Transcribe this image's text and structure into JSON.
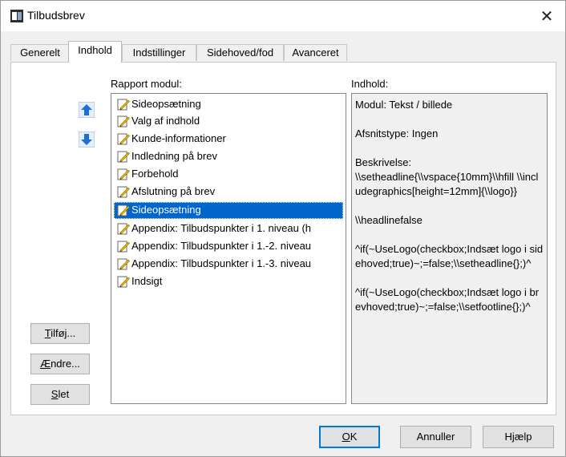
{
  "window": {
    "title": "Tilbudsbrev"
  },
  "tabs": [
    {
      "label": "Generelt"
    },
    {
      "label": "Indhold"
    },
    {
      "label": "Indstillinger"
    },
    {
      "label": "Sidehoved/fod"
    },
    {
      "label": "Avanceret"
    }
  ],
  "active_tab": "Indhold",
  "content": {
    "list_label": "Rapport modul:",
    "info_label": "Indhold:",
    "modules": [
      "Sideopsætning",
      "Valg af indhold",
      "Kunde-informationer",
      "Indledning på brev",
      "Forbehold",
      "Afslutning på brev",
      "Sideopsætning",
      "Appendix: Tilbudspunkter i 1. niveau (h",
      "Appendix: Tilbudspunkter i 1.-2. niveau",
      "Appendix: Tilbudspunkter i 1.-3. niveau",
      "Indsigt"
    ],
    "selected_module": "Sideopsætning",
    "info": {
      "modul": "Modul: Tekst / billede",
      "afsnitstype": "Afsnitstype: Ingen",
      "beskrivelse_label": "Beskrivelse:",
      "beskrivelse": "\\\\setheadline{\\\\vspace{10mm}\\\\hfill \\\\includegraphics[height=12mm]{\\\\logo}}",
      "headlinefalse": "\\\\headlinefalse",
      "if1": "^if(~UseLogo(checkbox;Indsæt logo i sidehoved;true)~;=false;\\\\setheadline{};)^",
      "if2": "^if(~UseLogo(checkbox;Indsæt logo i brevhoved;true)~;=false;\\\\setfootline{};)^"
    }
  },
  "side_buttons": {
    "add": {
      "mnemonic": "T",
      "rest": "ilføj..."
    },
    "edit": {
      "mnemonic": "Æ",
      "rest": "ndre..."
    },
    "delete": {
      "mnemonic": "S",
      "rest": "let"
    }
  },
  "buttons": {
    "ok": {
      "mnemonic": "O",
      "rest": "K"
    },
    "cancel": "Annuller",
    "help": "Hjælp"
  },
  "colors": {
    "selection": "#0066cc",
    "arrow": "#1c6fd6",
    "default_button_border": "#0078d7"
  },
  "icons": {
    "close": "close-icon",
    "up": "arrow-up-icon",
    "down": "arrow-down-icon",
    "module": "document-edit-icon"
  }
}
